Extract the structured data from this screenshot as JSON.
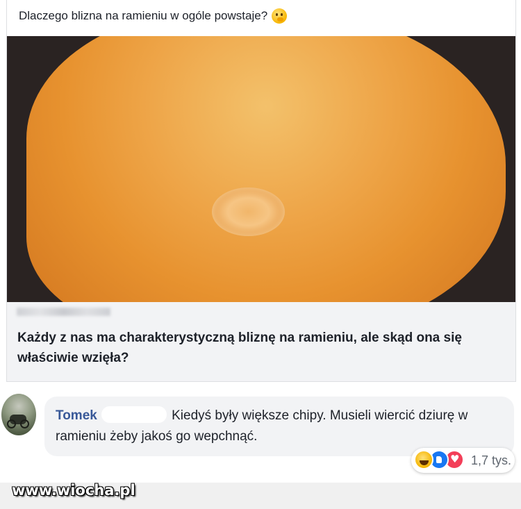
{
  "post": {
    "text": "Dlaczego blizna na ramieniu w ogóle powstaje?",
    "emoji": "thinking-face-emoji"
  },
  "link_preview": {
    "headline": "Każdy z nas ma charakterystyczną bliznę na ramieniu, ale skąd ona się właściwie wzięła?"
  },
  "comment": {
    "author": "Tomek",
    "text": "Kiedyś były większe chipy. Musieli wiercić dziurę w ramieniu żeby jakoś go wepchnąć.",
    "reactions": {
      "icons": [
        "haha-reaction-icon",
        "like-reaction-icon",
        "love-reaction-icon"
      ],
      "count": "1,7 tys.",
      "colors": {
        "like": "#1877f2",
        "love": "#f33e58",
        "haha": "#f5b400"
      }
    }
  },
  "watermark": "www.wiocha.pl",
  "colors": {
    "author_link": "#385898",
    "bubble_bg": "#f2f3f5",
    "caption_bg": "#f2f3f5",
    "text": "#1d2129"
  }
}
